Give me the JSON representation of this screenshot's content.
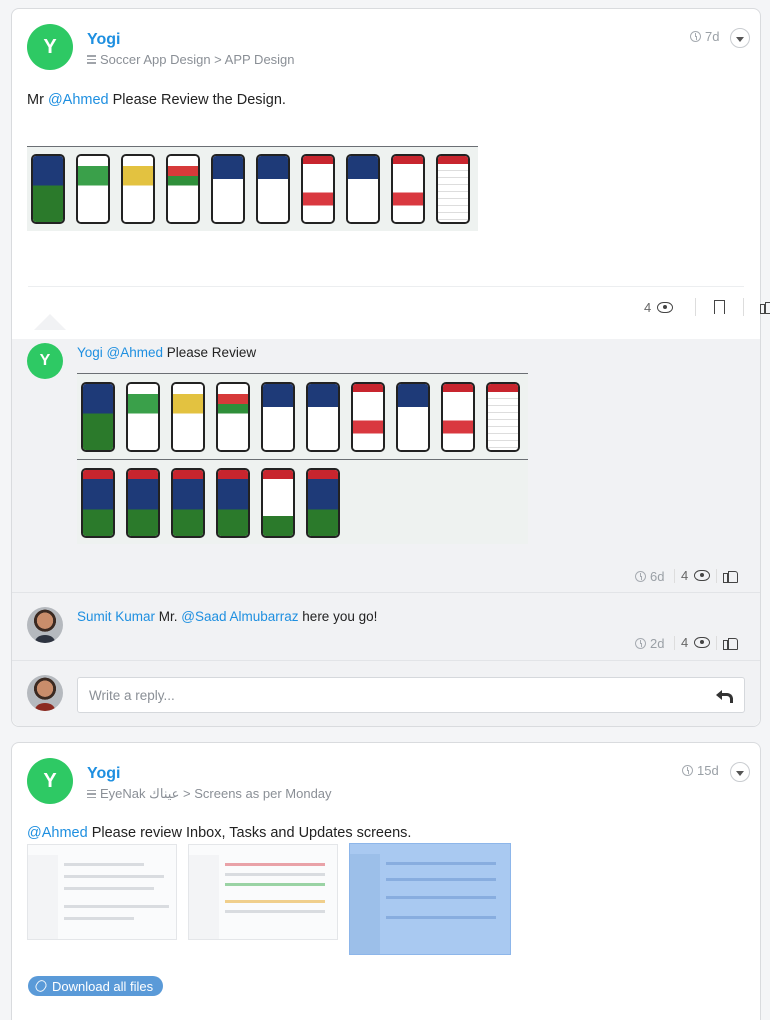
{
  "post1": {
    "author": "Yogi",
    "avatar_letter": "Y",
    "breadcrumb": "Soccer App Design > APP Design",
    "time": "7d",
    "text_prefix": "Mr ",
    "mention": "@Ahmed",
    "text_suffix": "  Please Review the Design.",
    "views": "4"
  },
  "comments": [
    {
      "author": "Yogi",
      "avatar_letter": "Y",
      "mention": "@Ahmed",
      "text": " Please Review",
      "time": "6d",
      "views": "4"
    },
    {
      "author": "Sumit Kumar",
      "prefix": " Mr. ",
      "mention": "@Saad Almubarraz",
      "text": " here you go!",
      "time": "2d",
      "views": "4"
    }
  ],
  "reply": {
    "placeholder": "Write a reply..."
  },
  "post2": {
    "author": "Yogi",
    "avatar_letter": "Y",
    "breadcrumb": "EyeNak عيناك > Screens as per Monday",
    "time": "15d",
    "mention": "@Ahmed",
    "text": " Please review Inbox, Tasks and Updates screens.",
    "download_label": "Download all files"
  },
  "colors": {
    "accent": "#1e8fe0",
    "avatar_green": "#2ec964",
    "download_bg": "#5a9ad8"
  }
}
